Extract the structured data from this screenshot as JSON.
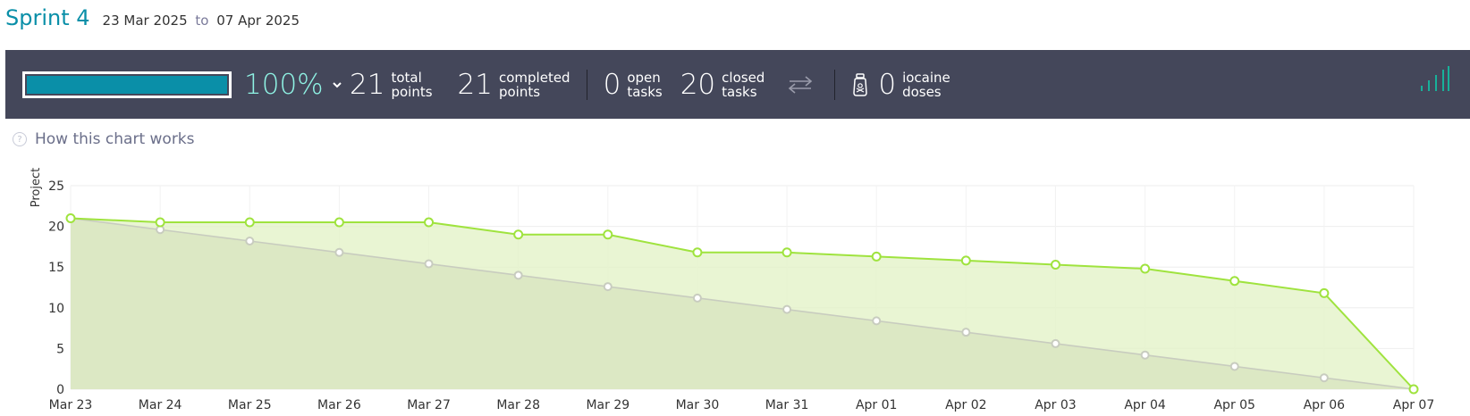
{
  "header": {
    "sprint_title": "Sprint 4",
    "start_date": "23 Mar 2025",
    "to": "to",
    "end_date": "07 Apr 2025"
  },
  "stats": {
    "progress_percent": 100,
    "percent_label": "100%",
    "total_points": "21",
    "total_label_1": "total",
    "total_label_2": "points",
    "completed_points": "21",
    "completed_label_1": "completed",
    "completed_label_2": "points",
    "open_tasks": "0",
    "open_label_1": "open",
    "open_label_2": "tasks",
    "closed_tasks": "20",
    "closed_label_1": "closed",
    "closed_label_2": "tasks",
    "iocaine_doses": "0",
    "iocaine_label_1": "iocaine",
    "iocaine_label_2": "doses"
  },
  "colors": {
    "accent": "#0a8fa8",
    "percent": "#8ff3e4",
    "bar_bg": "#44475a",
    "actual_line": "#9fe33e",
    "ideal_line": "#c8ccbf"
  },
  "icons": {
    "chevron": "chevron-down-icon",
    "swap": "swap-arrows-icon",
    "iocaine": "poison-jar-icon",
    "graph": "signal-bars-icon",
    "help": "question-circle-icon"
  },
  "help": {
    "text": "How this chart works",
    "icon_glyph": "?"
  },
  "chart_data": {
    "type": "area",
    "ylabel": "Project",
    "ylim": [
      0,
      25
    ],
    "y_ticks": [
      0,
      5,
      10,
      15,
      20,
      25
    ],
    "grid": true,
    "categories": [
      "Mar 23",
      "Mar 24",
      "Mar 25",
      "Mar 26",
      "Mar 27",
      "Mar 28",
      "Mar 29",
      "Mar 30",
      "Mar 31",
      "Apr 01",
      "Apr 02",
      "Apr 03",
      "Apr 04",
      "Apr 05",
      "Apr 06",
      "Apr 07"
    ],
    "series": [
      {
        "values": [
          21,
          19.6,
          18.2,
          16.8,
          15.4,
          14,
          12.6,
          11.2,
          9.8,
          8.4,
          7,
          5.6,
          4.2,
          2.8,
          1.4,
          0
        ]
      },
      {
        "values": [
          21,
          20.5,
          20.5,
          20.5,
          20.5,
          19,
          19,
          16.8,
          16.8,
          16.3,
          15.8,
          15.3,
          14.8,
          13.3,
          11.8,
          0
        ]
      }
    ]
  }
}
